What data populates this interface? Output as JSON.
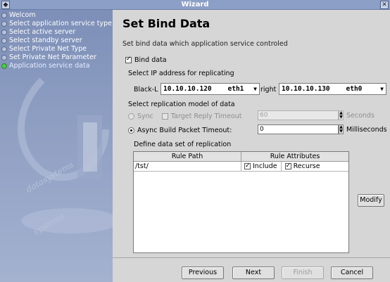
{
  "window": {
    "title": "Wizard",
    "menu_icon": "window-menu-icon",
    "close_icon": "close-icon"
  },
  "sidebar": {
    "items": [
      {
        "label": "Welcom",
        "active": false
      },
      {
        "label": "Select application service type",
        "active": false
      },
      {
        "label": "Select active server",
        "active": false
      },
      {
        "label": "Select standby server",
        "active": false
      },
      {
        "label": "Select Private Net Type",
        "active": false
      },
      {
        "label": "Set Private Net Parameter",
        "active": false
      },
      {
        "label": "Application service data",
        "active": true
      }
    ]
  },
  "main": {
    "title": "Set Bind Data",
    "subtitle": "Set bind data which application service controled",
    "bind_data": {
      "label": "Bind data",
      "checked": true
    },
    "ip_section": {
      "label": "Select IP address for replicating",
      "left_label": "Black-L",
      "left_value": "10.10.10.120    eth1",
      "right_label": "right",
      "right_value": "10.10.10.130    eth0"
    },
    "replication_model": {
      "label": "Select replication model of data",
      "sync": {
        "label": "Sync",
        "selected": false,
        "enabled": false
      },
      "target_timeout": {
        "label": "Target Reply Timeout",
        "value": "60",
        "unit": "Seconds",
        "enabled": false
      },
      "async": {
        "label": "Async Build Packet Timeout:",
        "selected": true,
        "value": "0",
        "unit": "Milliseconds"
      }
    },
    "data_set": {
      "label": "Define data set of replication",
      "columns": [
        "Rule Path",
        "Rule Attributes"
      ],
      "rows": [
        {
          "path": "/tst/",
          "include_label": "Include",
          "include": true,
          "recurse_label": "Recurse",
          "recurse": true
        }
      ]
    },
    "modify_button": "Modify"
  },
  "footer": {
    "previous": "Previous",
    "next": "Next",
    "finish": "Finish",
    "cancel": "Cancel"
  },
  "colors": {
    "title_bar": "#8c9fc7",
    "sidebar": "#8e9ec2",
    "active_step": "#4fc94f",
    "panel": "#d6d6d6"
  }
}
